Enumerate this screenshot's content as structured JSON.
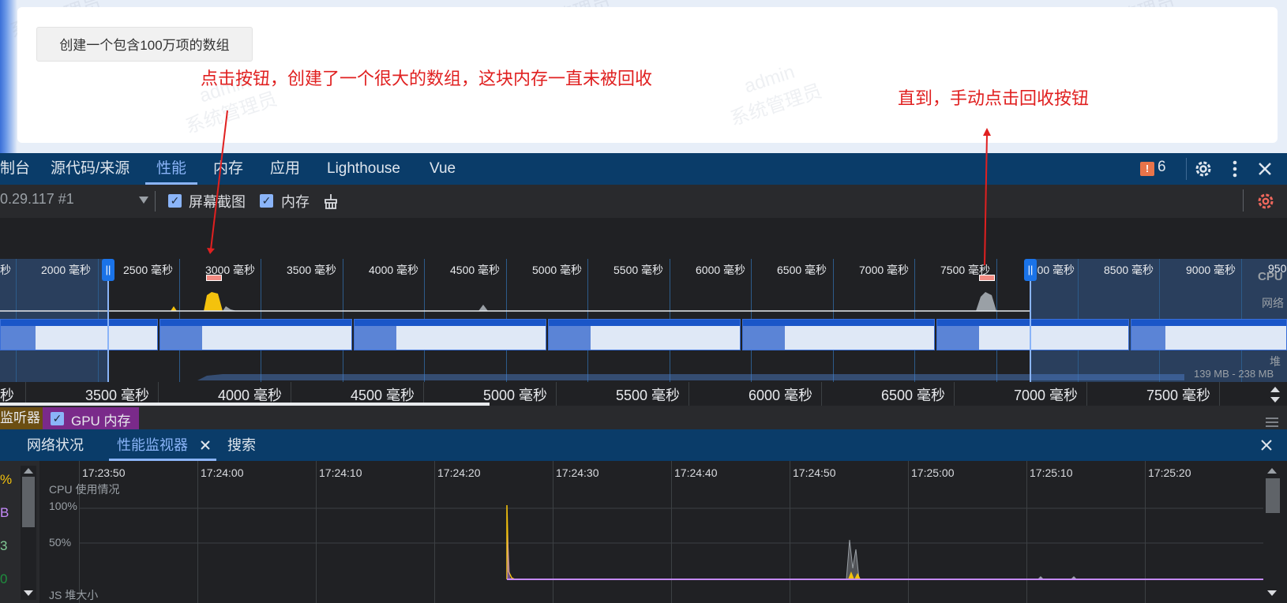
{
  "page": {
    "create_button": "创建一个包含100万项的数组",
    "annotation_left": "点击按钮，创建了一个很大的数组，这块内存一直未被回收",
    "annotation_right": "直到，手动点击回收按钮",
    "watermark_text": "admin",
    "watermark_name": "系统管理员"
  },
  "devtools": {
    "tabs": [
      "制台",
      "源代码/来源",
      "性能",
      "内存",
      "应用",
      "Lighthouse",
      "Vue"
    ],
    "active_tab": "性能",
    "issues_count": "6",
    "toolbar": {
      "recording": "0.29.117 #1",
      "screenshots_label": "屏幕截图",
      "memory_label": "内存"
    },
    "overview": {
      "ticks": [
        "秒",
        "2000 毫秒",
        "2500 毫秒",
        "3000 毫秒",
        "3500 毫秒",
        "4000 毫秒",
        "4500 毫秒",
        "5000 毫秒",
        "5500 毫秒",
        "6000 毫秒",
        "6500 毫秒",
        "7000 毫秒",
        "7500 毫秒",
        "8000 毫秒",
        "8500 毫秒",
        "9000 毫秒",
        "950"
      ],
      "cpu_label": "CPU",
      "net_label": "网络",
      "heap_label": "堆",
      "heap_range": "139 MB - 238 MB"
    },
    "timeline_ticks": [
      "秒",
      "3500 毫秒",
      "4000 毫秒",
      "4500 毫秒",
      "5000 毫秒",
      "5500 毫秒",
      "6000 毫秒",
      "6500 毫秒",
      "7000 毫秒",
      "7500 毫秒"
    ],
    "tracks": {
      "listeners_label": "监听器",
      "gpu_label": "GPU 内存"
    },
    "drawer": {
      "tabs": [
        "网络状况",
        "性能监视器",
        "搜索"
      ],
      "active_tab": "性能监视器"
    },
    "monitor": {
      "time_labels": [
        "17:23:50",
        "17:24:00",
        "17:24:10",
        "17:24:20",
        "17:24:30",
        "17:24:40",
        "17:24:50",
        "17:25:00",
        "17:25:10",
        "17:25:20"
      ],
      "cpu_title": "CPU 使用情况",
      "cpu_100": "100%",
      "cpu_50": "50%",
      "heap_title": "JS 堆大小",
      "side_values": [
        "%",
        "B",
        "3",
        "0"
      ]
    }
  },
  "colors": {
    "annotation": "#e02020",
    "devtools_header": "#0a3c69",
    "accent": "#8ab4f8",
    "cpu_yellow": "#f4c20d",
    "heap_purple": "#c58af9"
  }
}
